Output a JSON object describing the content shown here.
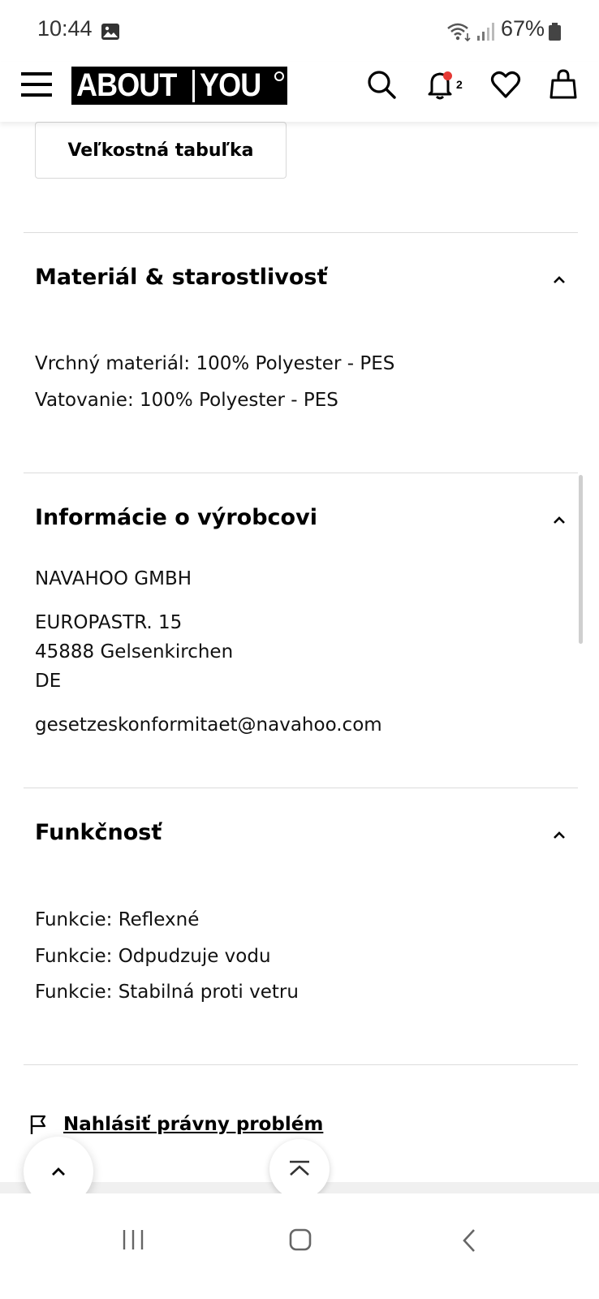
{
  "status_bar": {
    "time": "10:44",
    "battery_percent": "67%"
  },
  "header": {
    "logo_left": "ABOUT",
    "logo_right": "YOU",
    "notification_count": "2",
    "colors": {
      "notification_dot": "#e53935"
    }
  },
  "size_table_button": "Veľkostná tabuľka",
  "sections": {
    "material": {
      "title": "Materiál & starostlivosť",
      "lines": [
        "Vrchný materiál: 100% Polyester - PES",
        "Vatovanie: 100% Polyester - PES"
      ]
    },
    "manufacturer": {
      "title": "Informácie o výrobcovi",
      "name": "NAVAHOO GMBH",
      "street": "EUROPASTR. 15",
      "city": "45888 Gelsenkirchen",
      "country": "DE",
      "email": "gesetzeskonformitaet@navahoo.com"
    },
    "function": {
      "title": "Funkčnosť",
      "lines": [
        "Funkcie: Reflexné",
        "Funkcie: Odpudzuje vodu",
        "Funkcie: Stabilná proti vetru"
      ]
    }
  },
  "report_link": "Nahlásiť právny problém",
  "icons": [
    "image-icon",
    "wifi-icon",
    "signal-icon",
    "battery-icon",
    "menu-icon",
    "search-icon",
    "bell-icon",
    "heart-icon",
    "bag-icon",
    "chevron-up-icon",
    "flag-icon",
    "scroll-top-icon",
    "recent-apps-icon",
    "home-icon",
    "back-icon"
  ]
}
